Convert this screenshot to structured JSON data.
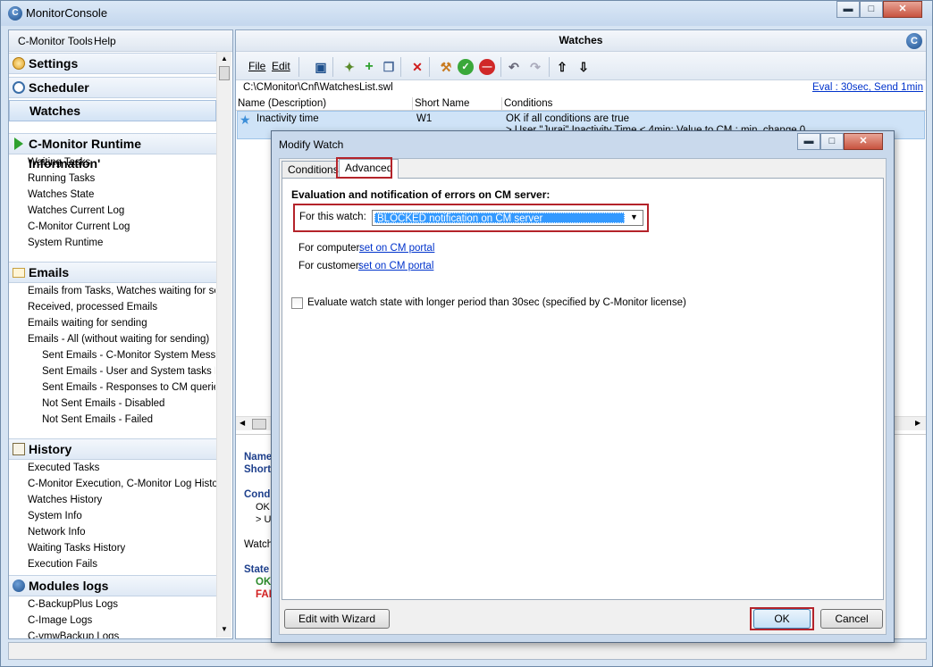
{
  "window": {
    "title": "MonitorConsole",
    "app_icon": "C"
  },
  "left_panel": {
    "menu": [
      "C-Monitor Tools",
      "Help"
    ],
    "sections": {
      "settings": "Settings",
      "scheduler": "Scheduler",
      "watches": "Watches",
      "runtime": "C-Monitor Runtime Information'",
      "emails": "Emails",
      "history": "History",
      "modules": "Modules logs"
    },
    "runtime_items": [
      "Waiting Tasks",
      "Running Tasks",
      "Watches State",
      "Watches Current Log",
      "C-Monitor Current Log",
      "System Runtime"
    ],
    "email_items": [
      "Emails from Tasks, Watches waiting for send",
      "Received, processed Emails",
      "Emails waiting for sending",
      "Emails - All (without waiting for sending)"
    ],
    "email_subitems": [
      "Sent Emails - C-Monitor System Message",
      "Sent Emails - User and System tasks Res",
      "Sent Emails - Responses to CM queries",
      "Not Sent Emails - Disabled",
      "Not Sent Emails - Failed"
    ],
    "history_items": [
      "Executed Tasks",
      "C-Monitor Execution, C-Monitor Log History",
      "Watches History",
      "System Info",
      "Network Info",
      "Waiting Tasks History",
      "Execution Fails"
    ],
    "module_items": [
      "C-BackupPlus Logs",
      "C-Image Logs",
      "C-vmwBackup Logs"
    ]
  },
  "right_panel": {
    "title": "Watches",
    "menu": [
      "File",
      "Edit"
    ],
    "path": "C:\\CMonitor\\Cnf\\WatchesList.swl",
    "eval_link": "Eval : 30sec, Send 1min",
    "columns": [
      "Name (Description)",
      "Short Name",
      "Conditions"
    ],
    "row": {
      "name": "Inactivity time",
      "short": "W1",
      "cond1": "OK if all conditions are true",
      "cond2": "> User \"Juraj\" Inactivity Time < 4min; Value to CM : min, change 0"
    },
    "detail": {
      "name": "Name",
      "short": "Short",
      "cond": "Conditi",
      "cond_ok": "OK",
      "cond_us": "> Us",
      "watch": "Watch",
      "state": "State",
      "state_ok": "OK",
      "state_fail": "FAI"
    }
  },
  "dialog": {
    "title": "Modify Watch",
    "tabs": [
      "Conditions",
      "Advanced"
    ],
    "heading": "Evaluation and notification of errors on CM server:",
    "for_watch_label": "For this watch:",
    "for_watch_value": "BLOCKED notification on CM server",
    "for_computer_label": "For computer:",
    "for_computer_link": "set on CM portal",
    "for_customer_label": "For customer:",
    "for_customer_link": "set on CM portal",
    "checkbox_label": "Evaluate watch state with longer period than 30sec (specified by C-Monitor license)",
    "wizard_button": "Edit with Wizard",
    "ok_button": "OK",
    "cancel_button": "Cancel"
  },
  "colors": {
    "accent": "#1d4f8c",
    "highlight": "#b4232a",
    "ok": "#2a8a2a",
    "fail": "#d32020"
  }
}
